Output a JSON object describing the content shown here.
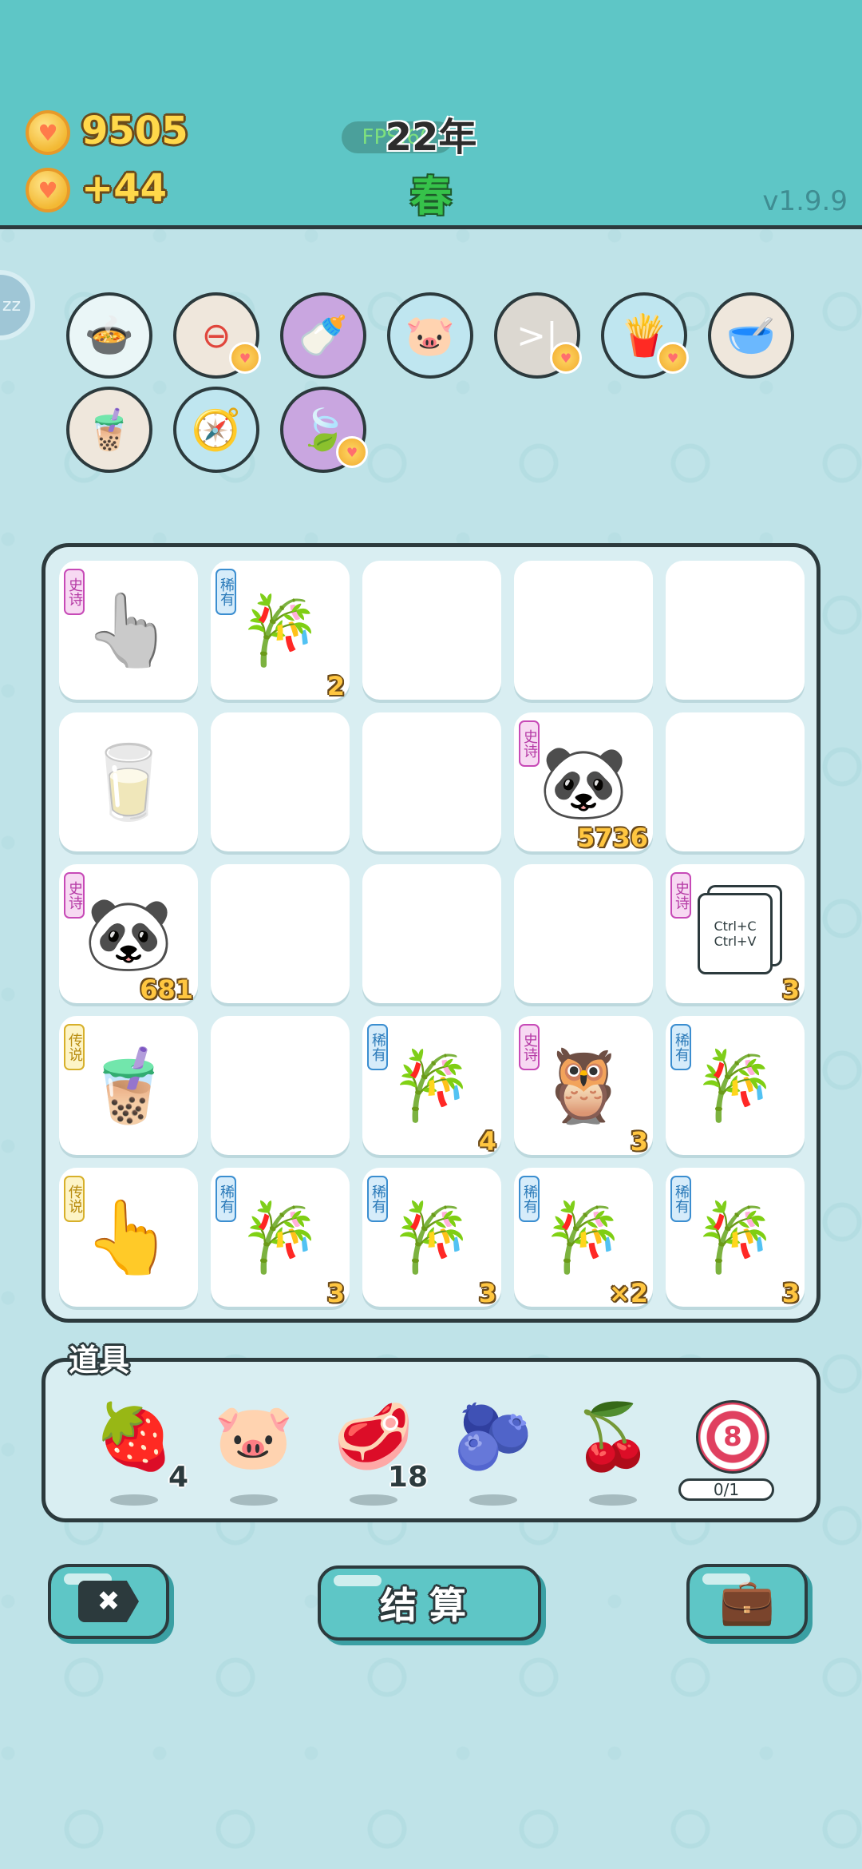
{
  "header": {
    "coins": "9505",
    "income": "+44",
    "fps": "FPS:60",
    "year": "22年",
    "season": "春",
    "version": "v1.9.9",
    "sleep": "zz"
  },
  "buffs": [
    {
      "name": "pot-duck",
      "glyph": "🍲",
      "bg": "#eaf6f7",
      "badge": false
    },
    {
      "name": "no-entry",
      "glyph": "⊖",
      "bg": "#efe7dc",
      "badge": true
    },
    {
      "name": "baby-bottle",
      "glyph": "🍼",
      "bg": "#c9a6e0",
      "badge": false
    },
    {
      "name": "piggy",
      "glyph": "🐷",
      "bg": "#bfe6f0",
      "badge": false
    },
    {
      "name": "skip",
      "glyph": ">|",
      "bg": "#dcd8d1",
      "badge": true
    },
    {
      "name": "fries",
      "glyph": "🍟",
      "bg": "#bfe6f0",
      "badge": true
    },
    {
      "name": "pet-food",
      "glyph": "🥣",
      "bg": "#efe7dc",
      "badge": false
    },
    {
      "name": "bubble-tea",
      "glyph": "🧋",
      "bg": "#efe7dc",
      "badge": false
    },
    {
      "name": "compass",
      "glyph": "🧭",
      "bg": "#bfe6f0",
      "badge": false
    },
    {
      "name": "leaf",
      "glyph": "🍃",
      "bg": "#c9a6e0",
      "badge": true
    }
  ],
  "tags": {
    "epic": "史诗",
    "rare": "稀有",
    "legend": "传说"
  },
  "grid": [
    [
      {
        "item": "gray-hand",
        "glyph": "👆",
        "tag": "epic",
        "count": ""
      },
      {
        "item": "bamboo",
        "glyph": "🎋",
        "tag": "rare",
        "count": "2"
      },
      {
        "item": "empty"
      },
      {
        "item": "empty"
      },
      {
        "item": "empty"
      }
    ],
    [
      {
        "item": "milk-bottle",
        "glyph": "🥛",
        "tag": "",
        "count": ""
      },
      {
        "item": "empty"
      },
      {
        "item": "empty"
      },
      {
        "item": "panda",
        "glyph": "🐼",
        "tag": "epic",
        "count": "5736"
      },
      {
        "item": "empty"
      }
    ],
    [
      {
        "item": "panda",
        "glyph": "🐼",
        "tag": "epic",
        "count": "681"
      },
      {
        "item": "empty"
      },
      {
        "item": "empty"
      },
      {
        "item": "empty"
      },
      {
        "item": "ctrl-c-v",
        "glyph": "📋",
        "tag": "epic",
        "count": "3",
        "text1": "Ctrl+C",
        "text2": "Ctrl+V"
      }
    ],
    [
      {
        "item": "bubble-tea-cup",
        "glyph": "🧋",
        "tag": "legend",
        "count": ""
      },
      {
        "item": "empty"
      },
      {
        "item": "bamboo",
        "glyph": "🎋",
        "tag": "rare",
        "count": "4"
      },
      {
        "item": "owl",
        "glyph": "🦉",
        "tag": "epic",
        "count": "3"
      },
      {
        "item": "bamboo",
        "glyph": "🎋",
        "tag": "rare",
        "count": ""
      }
    ],
    [
      {
        "item": "gold-hand",
        "glyph": "👆",
        "tag": "legend",
        "count": ""
      },
      {
        "item": "bamboo",
        "glyph": "🎋",
        "tag": "rare",
        "count": "3"
      },
      {
        "item": "bamboo",
        "glyph": "🎋",
        "tag": "rare",
        "count": "3"
      },
      {
        "item": "bamboo",
        "glyph": "🎋",
        "tag": "rare",
        "count": "×2"
      },
      {
        "item": "bamboo",
        "glyph": "🎋",
        "tag": "rare",
        "count": "3"
      }
    ]
  ],
  "items_bar": {
    "label": "道具",
    "items": [
      {
        "name": "strawberry",
        "glyph": "🍓",
        "count": "4"
      },
      {
        "name": "piggy-bank",
        "glyph": "🐷",
        "count": ""
      },
      {
        "name": "liver",
        "glyph": "🥩",
        "count": "18"
      },
      {
        "name": "blueberry",
        "glyph": "🫐",
        "count": ""
      },
      {
        "name": "lychee",
        "glyph": "🍒",
        "count": ""
      },
      {
        "name": "target-8",
        "glyph": "8",
        "count": "",
        "progress": "0/1"
      }
    ]
  },
  "buttons": {
    "close": "✖",
    "settle": "结算",
    "bag": "💼"
  },
  "colors": {
    "topbar": "#5ec6c6",
    "background": "#bfe3e8",
    "gold_text": "#ffd84a",
    "epic": "#c74ab7",
    "rare": "#3b8ed0",
    "legend": "#d7b02a"
  }
}
